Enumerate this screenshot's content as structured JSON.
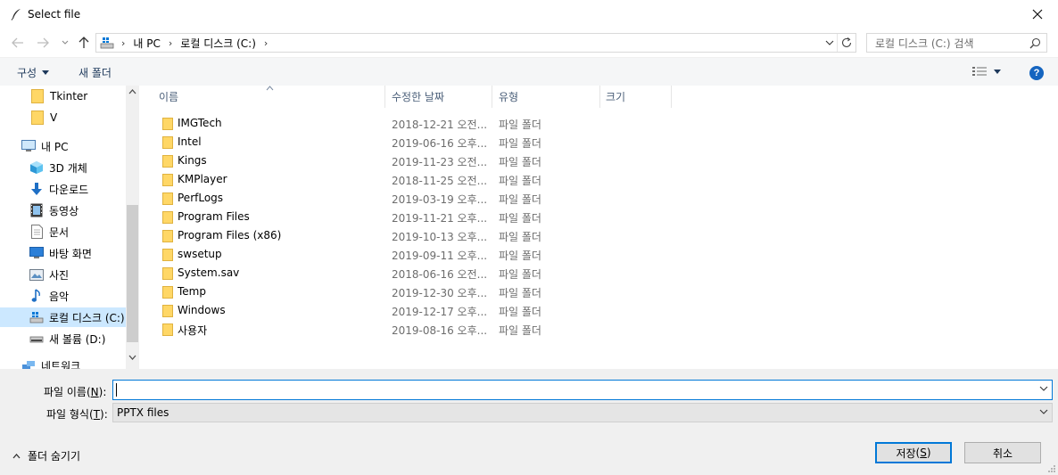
{
  "window": {
    "title": "Select file"
  },
  "address": {
    "segments": [
      "내 PC",
      "로컬 디스크 (C:)"
    ],
    "search_placeholder": "로컬 디스크 (C:) 검색"
  },
  "toolbar": {
    "organize_label": "구성",
    "new_folder_label": "새 폴더"
  },
  "sidebar": {
    "items": [
      {
        "label": "Tkinter",
        "icon": "folder-icon"
      },
      {
        "label": "V",
        "icon": "folder-icon"
      },
      {
        "label": "내 PC",
        "icon": "computer-icon"
      },
      {
        "label": "3D 개체",
        "icon": "3d-objects-icon"
      },
      {
        "label": "다운로드",
        "icon": "download-icon"
      },
      {
        "label": "동영상",
        "icon": "video-icon"
      },
      {
        "label": "문서",
        "icon": "document-icon"
      },
      {
        "label": "바탕 화면",
        "icon": "desktop-icon"
      },
      {
        "label": "사진",
        "icon": "pictures-icon"
      },
      {
        "label": "음악",
        "icon": "music-icon"
      },
      {
        "label": "로컬 디스크 (C:)",
        "icon": "local-disk-icon",
        "selected": true
      },
      {
        "label": "새 볼륨 (D:)",
        "icon": "drive-icon"
      },
      {
        "label": "네트워크",
        "icon": "network-icon"
      }
    ]
  },
  "columns": {
    "name": "이름",
    "date": "수정한 날짜",
    "type": "유형",
    "size": "크기"
  },
  "files": [
    {
      "name": "IMGTech",
      "date": "2018-12-21 오전...",
      "type": "파일 폴더"
    },
    {
      "name": "Intel",
      "date": "2019-06-16 오후...",
      "type": "파일 폴더"
    },
    {
      "name": "Kings",
      "date": "2019-11-23 오전...",
      "type": "파일 폴더"
    },
    {
      "name": "KMPlayer",
      "date": "2018-11-25 오전...",
      "type": "파일 폴더"
    },
    {
      "name": "PerfLogs",
      "date": "2019-03-19 오후...",
      "type": "파일 폴더"
    },
    {
      "name": "Program Files",
      "date": "2019-11-21 오후...",
      "type": "파일 폴더"
    },
    {
      "name": "Program Files (x86)",
      "date": "2019-10-13 오후...",
      "type": "파일 폴더"
    },
    {
      "name": "swsetup",
      "date": "2019-09-11 오후...",
      "type": "파일 폴더"
    },
    {
      "name": "System.sav",
      "date": "2018-06-16 오전...",
      "type": "파일 폴더"
    },
    {
      "name": "Temp",
      "date": "2019-12-30 오후...",
      "type": "파일 폴더"
    },
    {
      "name": "Windows",
      "date": "2019-12-17 오후...",
      "type": "파일 폴더"
    },
    {
      "name": "사용자",
      "date": "2019-08-16 오후...",
      "type": "파일 폴더"
    }
  ],
  "bottom": {
    "filename_label": "파일 이름",
    "filename_hotkey": "N",
    "filename_value": "",
    "filetype_label": "파일 형식",
    "filetype_hotkey": "T",
    "filetype_value": "PPTX files",
    "hide_folders_label": "폴더 숨기기",
    "save_label": "저장",
    "save_hotkey": "S",
    "cancel_label": "취소"
  },
  "colors": {
    "accent": "#0078d7",
    "selection": "#cce8ff",
    "folder": "#ffd766"
  }
}
